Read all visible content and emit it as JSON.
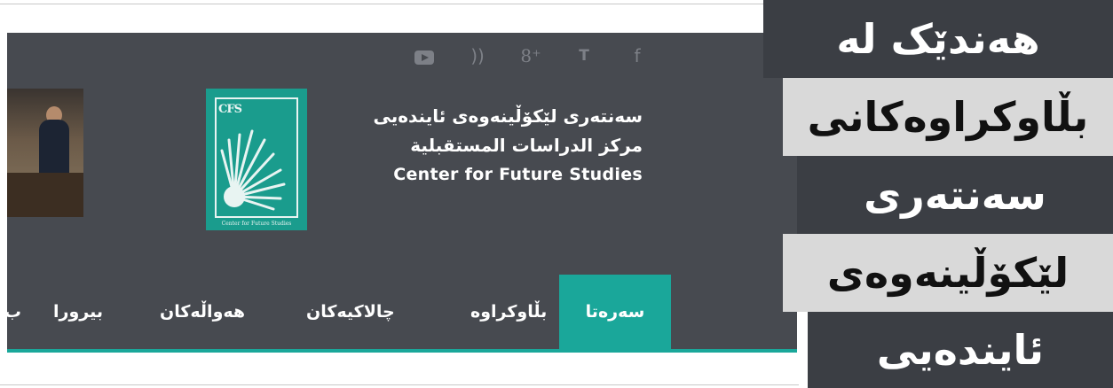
{
  "social_icons": [
    "youtube-icon",
    "rss-icon",
    "google-plus-icon",
    "twitter-icon",
    "facebook-icon"
  ],
  "social_glyphs": {
    "rss": "))",
    "gplus": "8⁺",
    "twitter": "🐦",
    "facebook": "f"
  },
  "logo": {
    "abbr": "CFS",
    "caption": "Center for Future Studies"
  },
  "titles": {
    "kurdish": "سەنتەری لێکۆڵینەوەی ئایندەیی",
    "arabic": "مركز الدراسات المستقبلية",
    "english": "Center for Future Studies"
  },
  "nav": {
    "items": [
      "سەرەتا",
      "بڵاوکراوە",
      "چالاکیەکان",
      "هەواڵەکان",
      "بیرورا",
      "ب"
    ]
  },
  "side_banner": {
    "lines": [
      "هەندێک لە",
      "بڵاوکراوەکانی",
      "سەنتەری",
      "لێکۆڵینەوەی",
      "ئایندەیی"
    ]
  },
  "colors": {
    "header_bg": "#474a50",
    "accent": "#1aa79a",
    "banner_dark": "#3b3e44",
    "banner_light": "#d9d9d9"
  }
}
